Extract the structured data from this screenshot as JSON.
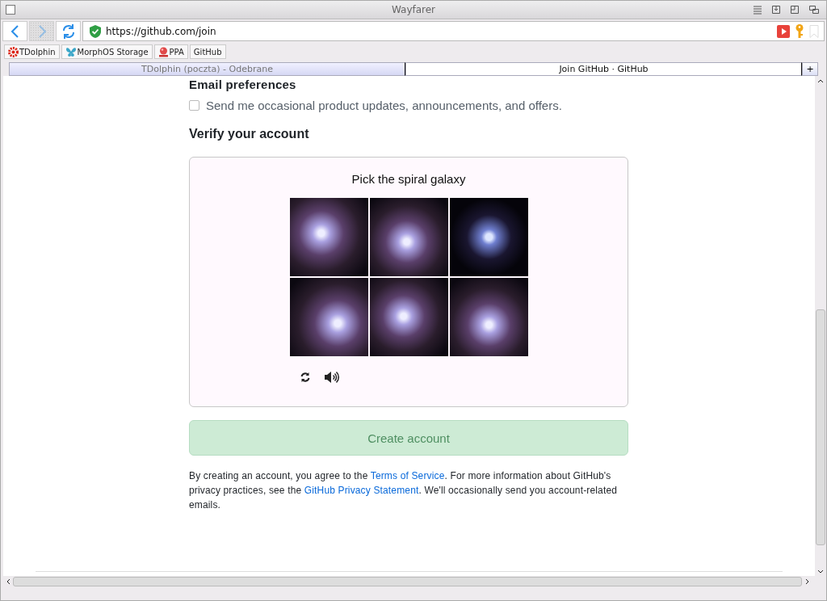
{
  "window": {
    "title": "Wayfarer"
  },
  "toolbar": {
    "back_disabled": false,
    "forward_disabled": true,
    "url": "https://github.com/join"
  },
  "bookmarks": [
    {
      "label": "TDolphin",
      "kind": "gear"
    },
    {
      "label": "MorphOS Storage",
      "kind": "butterfly"
    },
    {
      "label": "PPA",
      "kind": "ppa"
    },
    {
      "label": "GitHub",
      "kind": "none"
    }
  ],
  "tabs": [
    {
      "label": "TDolphin (poczta) - Odebrane",
      "selected": false
    },
    {
      "label": "Join GitHub · GitHub",
      "selected": true
    }
  ],
  "new_tab": "+",
  "page": {
    "email_heading": "Email preferences",
    "email_option": {
      "label": "Send me occasional product updates, announcements, and offers.",
      "checked": false
    },
    "verify_heading": "Verify your account",
    "captcha": {
      "prompt": "Pick the spiral galaxy",
      "tiles": [
        {
          "kind": "cluster"
        },
        {
          "kind": "cluster"
        },
        {
          "kind": "spiral"
        },
        {
          "kind": "cluster"
        },
        {
          "kind": "cluster"
        },
        {
          "kind": "cluster"
        }
      ]
    },
    "create_button": {
      "label": "Create account",
      "disabled": true
    },
    "legal": [
      {
        "kind": "text",
        "text": "By creating an account, you agree to the "
      },
      {
        "kind": "link",
        "text": "Terms of Service"
      },
      {
        "kind": "text",
        "text": ". For more information about GitHub's privacy practices, see the "
      },
      {
        "kind": "link",
        "text": "GitHub Privacy Statement"
      },
      {
        "kind": "text",
        "text": ". We'll occasionally send you account-related emails."
      }
    ]
  }
}
